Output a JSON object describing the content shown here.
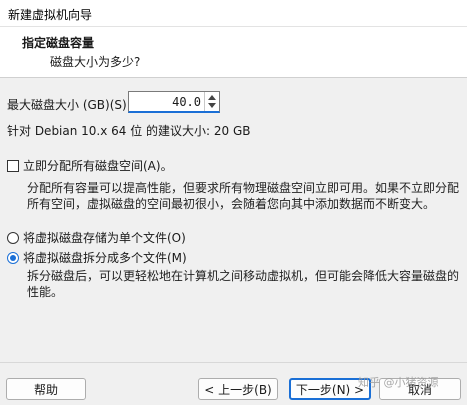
{
  "window": {
    "title": "新建虚拟机向导"
  },
  "header": {
    "title": "指定磁盘容量",
    "subtitle": "磁盘大小为多少?"
  },
  "disk_size": {
    "label": "最大磁盘大小 (GB)(S):",
    "value": "40.0"
  },
  "recommendation": "针对 Debian 10.x 64 位 的建议大小: 20 GB",
  "allocate_all": {
    "label": "立即分配所有磁盘空间(A)。",
    "checked": false,
    "description": "分配所有容量可以提高性能，但要求所有物理磁盘空间立即可用。如果不立即分配所有空间，虚拟磁盘的空间最初很小，会随着您向其中添加数据而不断变大。"
  },
  "storage_options": [
    {
      "label": "将虚拟磁盘存储为单个文件(O)",
      "selected": false
    },
    {
      "label": "将虚拟磁盘拆分成多个文件(M)",
      "selected": true
    }
  ],
  "split_description": "拆分磁盘后，可以更轻松地在计算机之间移动虚拟机，但可能会降低大容量磁盘的性能。",
  "buttons": {
    "help": "帮助",
    "back": "< 上一步(B)",
    "next": "下一步(N) >",
    "cancel": "取消"
  },
  "watermark": "知乎 @小猪资源"
}
